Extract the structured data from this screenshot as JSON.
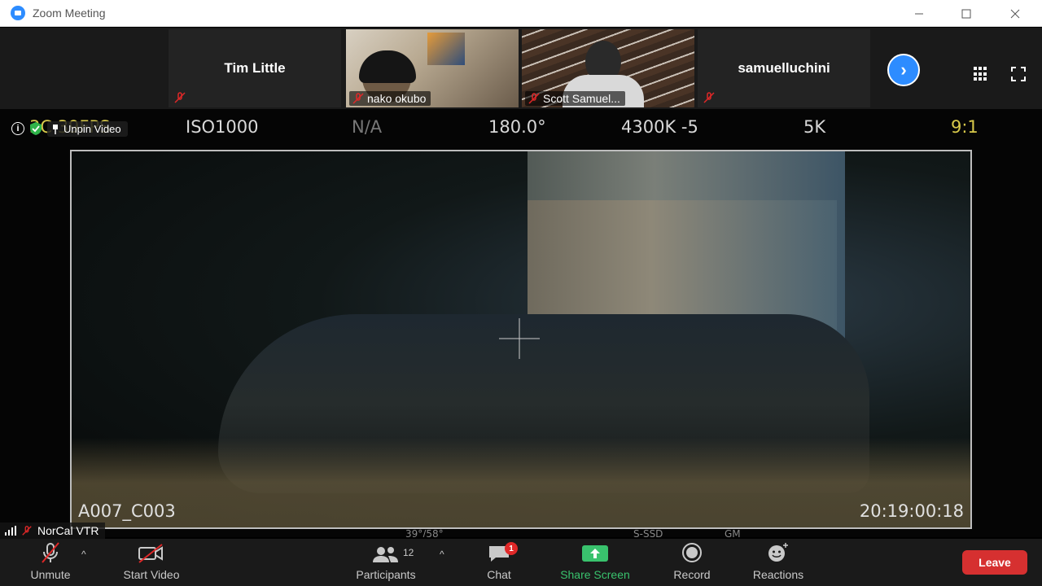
{
  "window": {
    "title": "Zoom Meeting"
  },
  "participants_strip": [
    {
      "name": "Tim Little",
      "video": false,
      "muted": true
    },
    {
      "name": "nako okubo",
      "video": true,
      "muted": true
    },
    {
      "name": "Scott Samuel...",
      "video": true,
      "muted": true
    },
    {
      "name": "samuelluchini",
      "video": false,
      "muted": true
    }
  ],
  "main_video": {
    "hud_top": {
      "fps": "3C 39FPS",
      "iso": "ISO1000",
      "nd": "N/A",
      "shutter": "180.0°",
      "wb": "4300K -5",
      "res": "5K",
      "aspect": "9:1"
    },
    "clip_name": "A007_C003",
    "timecode": "20:19:00:18",
    "hud_bottom": {
      "temp": "39°/58°",
      "media": "S-SSD",
      "gm": "GM"
    },
    "pin_label": "Unpin Video",
    "speaker_name": "NorCal VTR"
  },
  "toolbar": {
    "unmute": "Unmute",
    "start_video": "Start Video",
    "participants": "Participants",
    "participants_count": "12",
    "chat": "Chat",
    "chat_badge": "1",
    "share_screen": "Share Screen",
    "record": "Record",
    "reactions": "Reactions",
    "leave": "Leave"
  },
  "colors": {
    "accent": "#2d8cff",
    "share": "#39c26d",
    "leave": "#d63030",
    "badge": "#e02828"
  }
}
